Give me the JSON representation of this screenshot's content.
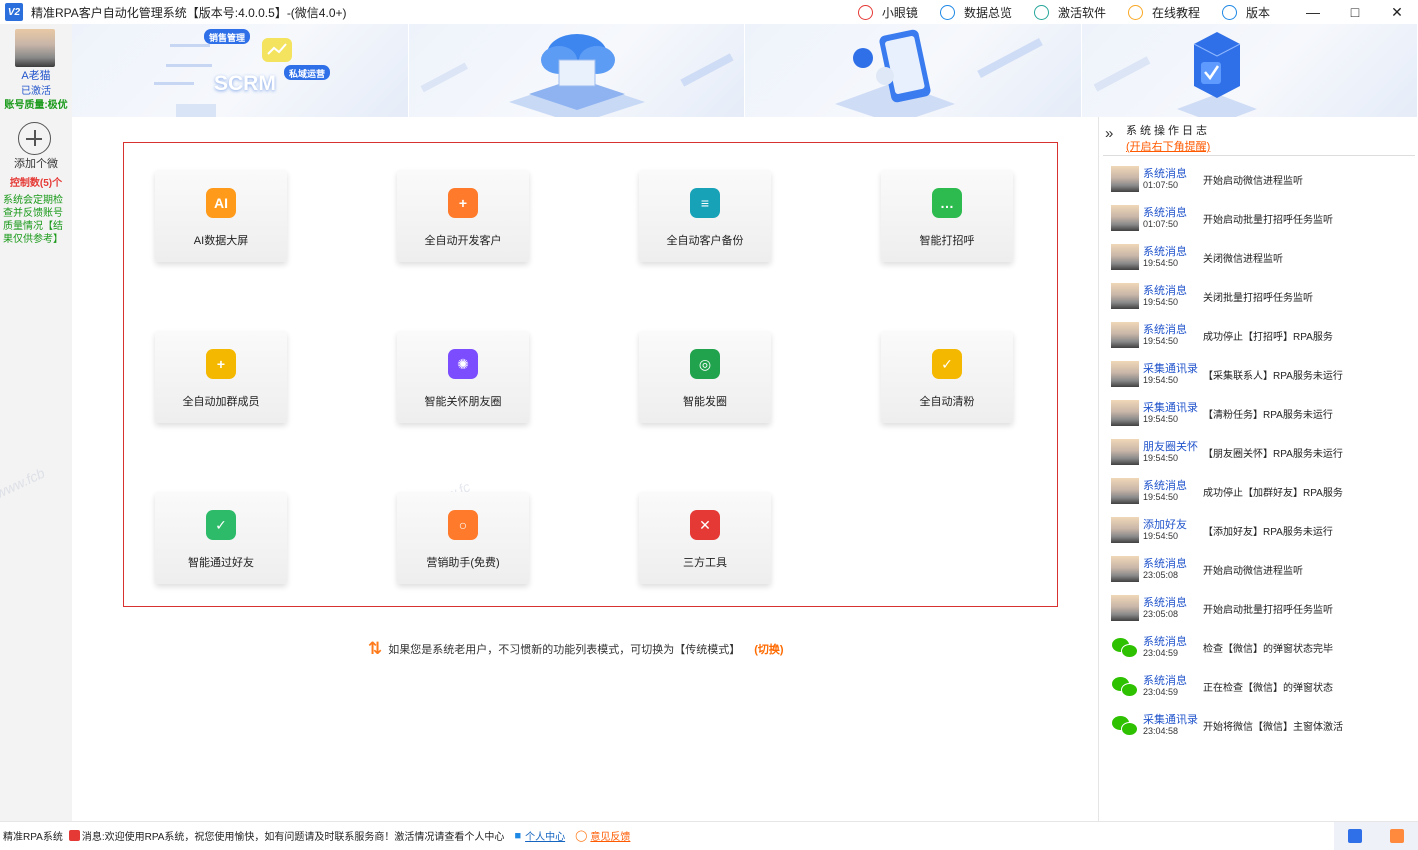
{
  "titlebar": {
    "app_title": "精准RPA客户自动化管理系统【版本号:4.0.0.5】-(微信4.0+)",
    "logo_text": "V2",
    "items": [
      {
        "name": "little-eye",
        "label": "小眼镜",
        "icon": "eye-icon",
        "color": "#e53935"
      },
      {
        "name": "data-overview",
        "label": "数据总览",
        "icon": "document-icon",
        "color": "#1e88e5"
      },
      {
        "name": "activate-software",
        "label": "激活软件",
        "icon": "shield-icon",
        "color": "#26a69a"
      },
      {
        "name": "online-tutorial",
        "label": "在线教程",
        "icon": "help-icon",
        "color": "#f9a825"
      },
      {
        "name": "version",
        "label": "版本",
        "icon": "info-icon",
        "color": "#1e88e5"
      }
    ]
  },
  "banner": {
    "panel1": {
      "tag1": "销售管理",
      "tag2": "私域运营",
      "brand": "SCRM"
    }
  },
  "sidebar": {
    "user_name": "A老猫",
    "user_status": "已激活",
    "user_quality": "账号质量:极优",
    "add_label": "添加个微",
    "control_count": "控制数(5)个",
    "note": "系统会定期检查并反馈账号质量情况【结果仅供参考】"
  },
  "functions": [
    {
      "name": "ai-dashboard",
      "label": "AI数据大屏",
      "icon": "ai-icon",
      "color": "#ff9a1a"
    },
    {
      "name": "auto-develop-customers",
      "label": "全自动开发客户",
      "icon": "add-person-icon",
      "color": "#ff7a2a"
    },
    {
      "name": "auto-customer-backup",
      "label": "全自动客户备份",
      "icon": "database-icon",
      "color": "#17a2b8"
    },
    {
      "name": "smart-greeting",
      "label": "智能打招呼",
      "icon": "chat-icon",
      "color": "#2dbb4f"
    },
    {
      "name": "auto-add-group-members",
      "label": "全自动加群成员",
      "icon": "group-add-icon",
      "color": "#f5b800"
    },
    {
      "name": "smart-moments-care",
      "label": "智能关怀朋友圈",
      "icon": "aperture-icon",
      "color": "#7c4dff"
    },
    {
      "name": "smart-post-moments",
      "label": "智能发圈",
      "icon": "moments-icon",
      "color": "#21a34d"
    },
    {
      "name": "auto-clean-fans",
      "label": "全自动清粉",
      "icon": "broom-icon",
      "color": "#f5b800"
    },
    {
      "name": "smart-accept-friends",
      "label": "智能通过好友",
      "icon": "friend-accept-icon",
      "color": "#2dbb6a"
    },
    {
      "name": "marketing-assistant",
      "label": "营销助手(免费)",
      "icon": "lifebuoy-icon",
      "color": "#ff7a2a"
    },
    {
      "name": "third-party-tools",
      "label": "三方工具",
      "icon": "tools-icon",
      "color": "#e53935"
    }
  ],
  "switch_mode": {
    "text": "如果您是系统老用户，不习惯新的功能列表模式，可切换为【传统模式】",
    "link": "(切换)"
  },
  "log": {
    "title": "系统操作日志",
    "remind": "(开启右下角提醒)",
    "entries": [
      {
        "source": "系统消息",
        "time": "01:07:50",
        "message": "开始启动微信进程监听",
        "avatar": "user"
      },
      {
        "source": "系统消息",
        "time": "01:07:50",
        "message": "开始启动批量打招呼任务监听",
        "avatar": "user"
      },
      {
        "source": "系统消息",
        "time": "19:54:50",
        "message": "关闭微信进程监听",
        "avatar": "user"
      },
      {
        "source": "系统消息",
        "time": "19:54:50",
        "message": "关闭批量打招呼任务监听",
        "avatar": "user"
      },
      {
        "source": "系统消息",
        "time": "19:54:50",
        "message": "成功停止【打招呼】RPA服务",
        "avatar": "user"
      },
      {
        "source": "采集通讯录",
        "time": "19:54:50",
        "message": "【采集联系人】RPA服务未运行",
        "avatar": "user"
      },
      {
        "source": "采集通讯录",
        "time": "19:54:50",
        "message": "【清粉任务】RPA服务未运行",
        "avatar": "user"
      },
      {
        "source": "朋友圈关怀",
        "time": "19:54:50",
        "message": "【朋友圈关怀】RPA服务未运行",
        "avatar": "user"
      },
      {
        "source": "系统消息",
        "time": "19:54:50",
        "message": "成功停止【加群好友】RPA服务",
        "avatar": "user"
      },
      {
        "source": "添加好友",
        "time": "19:54:50",
        "message": "【添加好友】RPA服务未运行",
        "avatar": "user"
      },
      {
        "source": "系统消息",
        "time": "23:05:08",
        "message": "开始启动微信进程监听",
        "avatar": "user"
      },
      {
        "source": "系统消息",
        "time": "23:05:08",
        "message": "开始启动批量打招呼任务监听",
        "avatar": "user"
      },
      {
        "source": "系统消息",
        "time": "23:04:59",
        "message": "检查【微信】的弹窗状态完毕",
        "avatar": "wechat"
      },
      {
        "source": "系统消息",
        "time": "23:04:59",
        "message": "正在检查【微信】的弹窗状态",
        "avatar": "wechat"
      },
      {
        "source": "采集通讯录",
        "time": "23:04:58",
        "message": "开始将微信【微信】主窗体激活",
        "avatar": "wechat"
      }
    ]
  },
  "statusbar": {
    "app": "精准RPA系统",
    "message": "消息:欢迎使用RPA系统，祝您使用愉快，如有问题请及时联系服务商！激活情况请查看个人中心",
    "personal_center": "个人中心",
    "feedback": "意见反馈"
  }
}
